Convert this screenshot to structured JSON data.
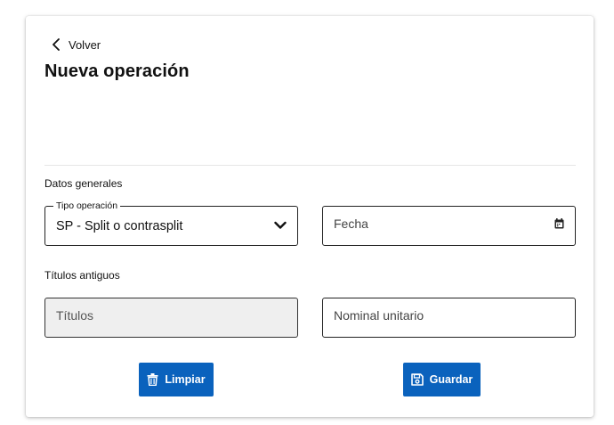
{
  "nav": {
    "back_label": "Volver"
  },
  "page": {
    "title": "Nueva operación"
  },
  "sections": {
    "general": "Datos generales",
    "old_titles": "Títulos antiguos"
  },
  "form": {
    "operation_type": {
      "legend": "Tipo operación",
      "value": "SP - Split o contrasplit"
    },
    "date": {
      "placeholder": "Fecha"
    },
    "titles": {
      "placeholder": "Títulos"
    },
    "unit_nominal": {
      "placeholder": "Nominal unitario"
    }
  },
  "actions": {
    "clear_label": "Limpiar",
    "save_label": "Guardar"
  },
  "colors": {
    "primary": "#0a62bd",
    "disabled_bg": "#efefef"
  },
  "icons": {
    "back": "chevron-left-icon",
    "select": "chevron-down-icon",
    "date": "calendar-icon",
    "clear": "trash-icon",
    "save": "floppy-disk-icon"
  }
}
